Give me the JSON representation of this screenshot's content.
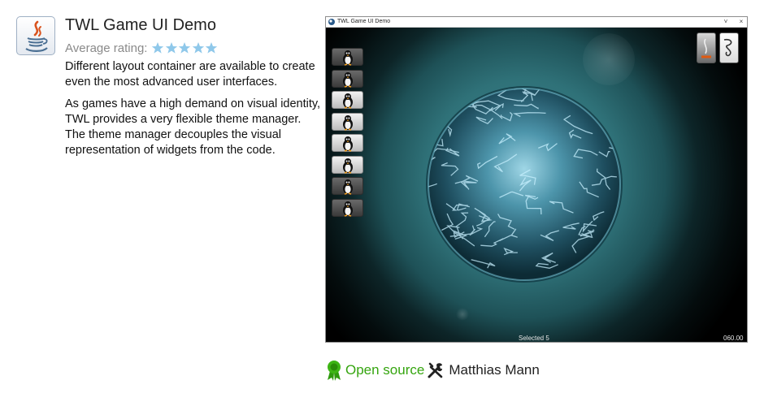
{
  "app": {
    "title": "TWL Game UI Demo",
    "icon": "java-icon",
    "rating_label": "Average rating:",
    "rating_stars": 5,
    "star_color": "#8fc8ea",
    "description": [
      "Different layout container are available to create even the most advanced user interfaces.",
      "As games have a high demand on visual identity, TWL provides a very flexible theme manager. The theme manager decouples the visual representation of widgets from the code."
    ]
  },
  "screenshot": {
    "window_title": "TWL Game UI Demo",
    "controls": {
      "minimize": "˅",
      "close": "×"
    },
    "status": "Selected 5",
    "fps": "060.00",
    "penguin_buttons": [
      "penguin-icon",
      "penguin-icon",
      "penguin-icon",
      "penguin-icon",
      "penguin-icon",
      "penguin-icon",
      "penguin-icon",
      "penguin-icon"
    ],
    "active_buttons": [
      2,
      3,
      4,
      5
    ],
    "corner_buttons": [
      "flame-icon",
      "scribble-icon"
    ]
  },
  "footer": {
    "license": "Open source",
    "license_icon": "award-ribbon-icon",
    "license_color": "#35a50f",
    "author_icon": "tools-icon",
    "author": "Matthias Mann"
  }
}
